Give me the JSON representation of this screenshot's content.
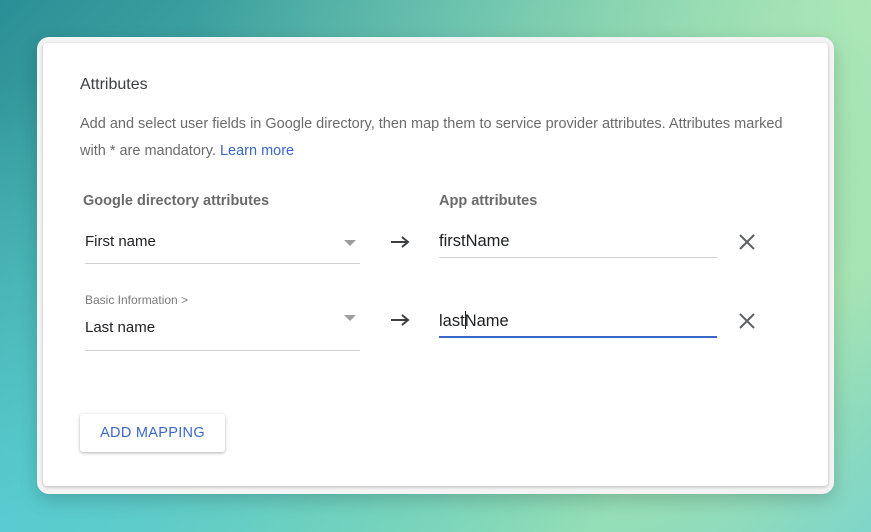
{
  "section": {
    "title": "Attributes",
    "description": "Add and select user fields in Google directory, then map them to service provider attributes. Attributes marked with * are mandatory.",
    "learn_more": "Learn more"
  },
  "columns": {
    "left": "Google directory attributes",
    "right": "App attributes"
  },
  "mappings": [
    {
      "category": "",
      "directory_attribute": "First name",
      "app_attribute": "firstName",
      "focused": false
    },
    {
      "category": "Basic Information >",
      "directory_attribute": "Last name",
      "app_attribute_before_cursor": "last",
      "app_attribute_after_cursor": "Name",
      "focused": true
    }
  ],
  "icons": {
    "dropdown": "dropdown-caret-icon",
    "arrow": "arrow-right-icon",
    "remove": "close-icon"
  },
  "colors": {
    "accent": "#3b67c7",
    "text": "#202124",
    "muted": "#6b6b6b"
  },
  "actions": {
    "add_mapping": "ADD MAPPING"
  }
}
